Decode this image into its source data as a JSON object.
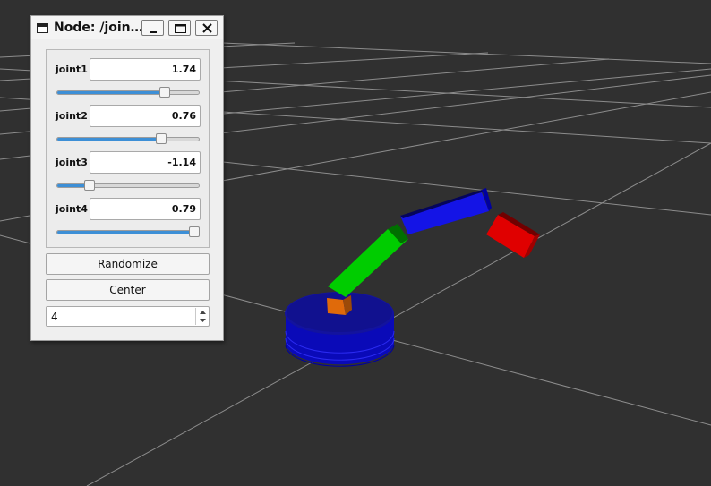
{
  "window": {
    "title": "Node: /join…",
    "title_icon": "window-icon",
    "controls": [
      "minimize-icon",
      "maximize-icon",
      "close-icon"
    ]
  },
  "joints": [
    {
      "label": "joint1",
      "value": "1.74",
      "slider_fraction": 0.78
    },
    {
      "label": "joint2",
      "value": "0.76",
      "slider_fraction": 0.75
    },
    {
      "label": "joint3",
      "value": "-1.14",
      "slider_fraction": 0.21
    },
    {
      "label": "joint4",
      "value": "0.79",
      "slider_fraction": 1.0
    }
  ],
  "buttons": {
    "randomize": "Randomize",
    "center": "Center"
  },
  "spinbox": {
    "value": "4"
  },
  "colors": {
    "background": "#303030",
    "grid": "#8a8a8a",
    "base": "#1a1acc",
    "joint_block": "#e06a0a",
    "lower_arm": "#00cc00",
    "upper_arm": "#1010dd",
    "end_effector": "#dd0000",
    "slider_fill": "#3d8fd6"
  }
}
